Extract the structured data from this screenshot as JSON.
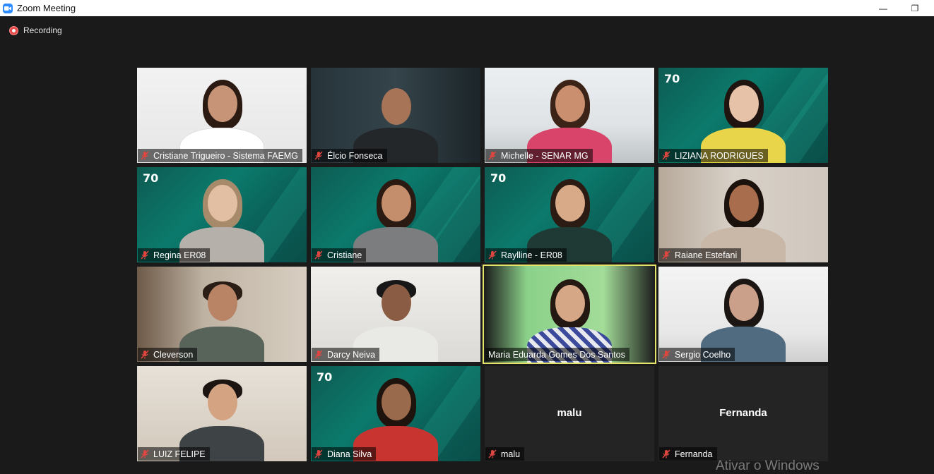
{
  "window": {
    "title": "Zoom Meeting",
    "minimize_glyph": "—",
    "restore_glyph": "❐"
  },
  "recording": {
    "label": "Recording"
  },
  "participants": [
    {
      "name": "Cristiane Trigueiro - Sistema FAEMG",
      "muted": true
    },
    {
      "name": "Élcio Fonseca",
      "muted": true
    },
    {
      "name": "Michelle - SENAR MG",
      "muted": true
    },
    {
      "name": "LIZIANA RODRIGUES",
      "muted": true
    },
    {
      "name": "Regina ER08",
      "muted": true
    },
    {
      "name": "Cristiane",
      "muted": true
    },
    {
      "name": "Raylline - ER08",
      "muted": true
    },
    {
      "name": "Raiane Estefani",
      "muted": true
    },
    {
      "name": "Cleverson",
      "muted": true
    },
    {
      "name": "Darcy Neiva",
      "muted": true
    },
    {
      "name": "Maria Eduarda Gomes Dos Santos",
      "muted": false,
      "active_speaker": true
    },
    {
      "name": "Sergio Coelho",
      "muted": true
    },
    {
      "name": "LUIZ FELIPE",
      "muted": true
    },
    {
      "name": "Diana Silva",
      "muted": true
    },
    {
      "name": "malu",
      "muted": true,
      "video_off": true,
      "display_name": "malu"
    },
    {
      "name": "Fernanda",
      "muted": true,
      "video_off": true,
      "display_name": "Fernanda"
    }
  ],
  "badge_text": "70",
  "watermark": "Ativar o Windows",
  "colors": {
    "active_border": "#e4e46a",
    "muted_icon": "#e0463f",
    "recording": "#e54b4b",
    "zoom_blue": "#2d8cff"
  }
}
